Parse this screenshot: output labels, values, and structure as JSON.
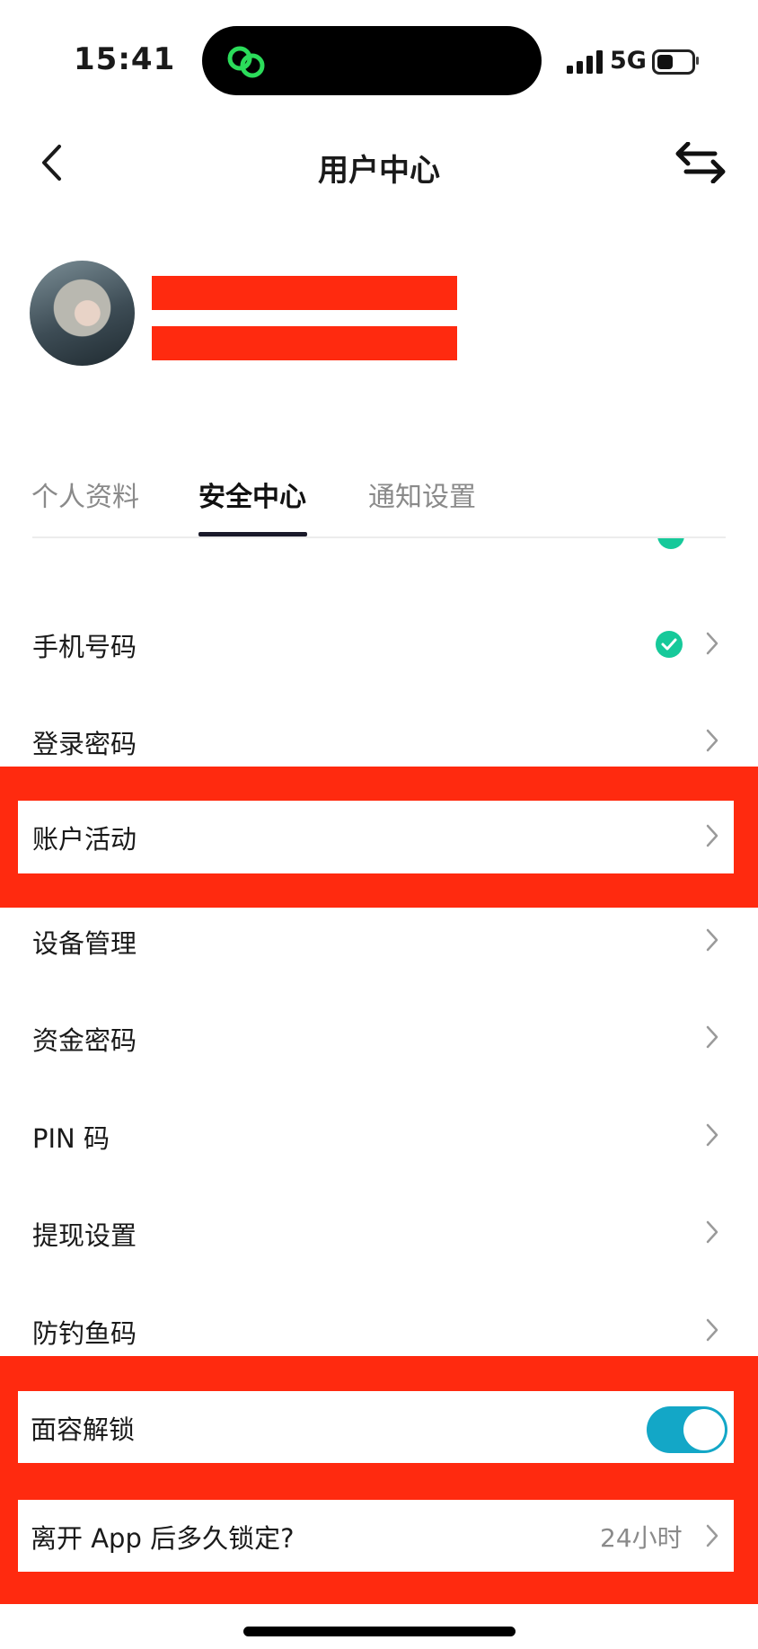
{
  "status_bar": {
    "time": "15:41",
    "network": "5G"
  },
  "header": {
    "title": "用户中心",
    "back_icon": "chevron-left-icon",
    "swap_icon": "swap-arrows-icon"
  },
  "tabs": [
    {
      "label": "个人资料",
      "active": false
    },
    {
      "label": "安全中心",
      "active": true
    },
    {
      "label": "通知设置",
      "active": false
    }
  ],
  "security_items": [
    {
      "label": "手机号码",
      "verified": true
    },
    {
      "label": "登录密码"
    },
    {
      "label": "账户活动"
    },
    {
      "label": "设备管理"
    },
    {
      "label": "资金密码"
    },
    {
      "label": "PIN 码"
    },
    {
      "label": "提现设置"
    },
    {
      "label": "防钓鱼码"
    }
  ],
  "face_unlock": {
    "label": "面容解锁",
    "enabled": true
  },
  "auto_lock": {
    "label": "离开 App 后多久锁定?",
    "value": "24小时"
  },
  "colors": {
    "accent_toggle": "#13a7c7",
    "verified_green": "#16c99a",
    "redaction_red": "#ff2a0f"
  }
}
